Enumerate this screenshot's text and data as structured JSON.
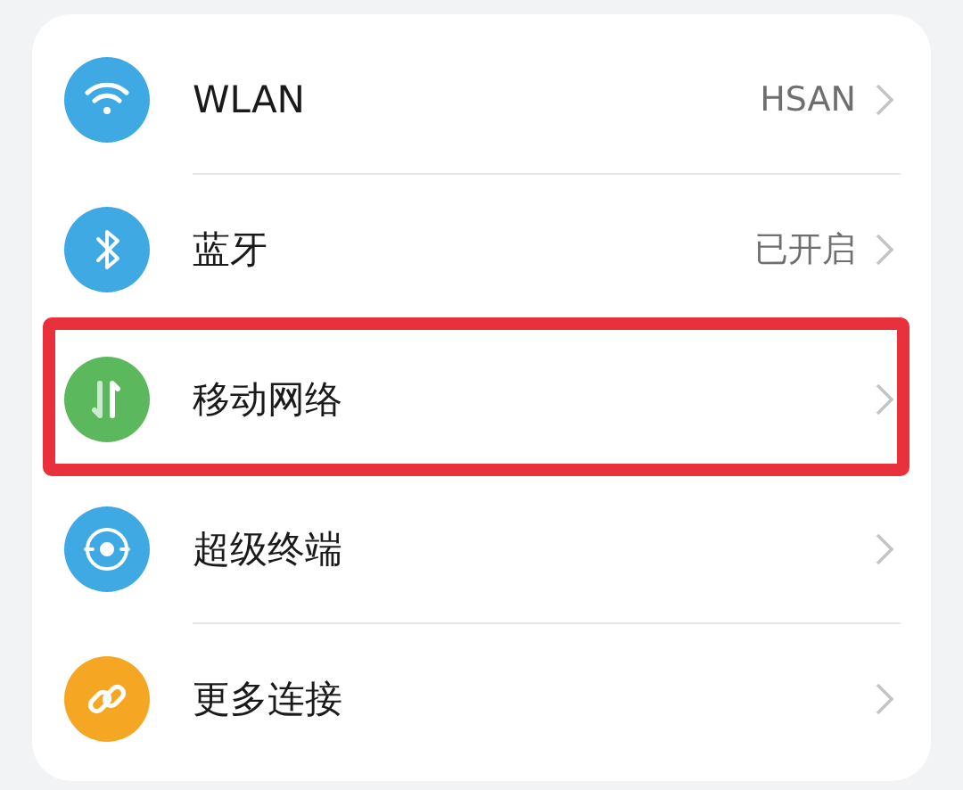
{
  "items": [
    {
      "kind": "wifi",
      "color": "#3fa9e4",
      "label": "WLAN",
      "value": "HSAN",
      "highlighted": false
    },
    {
      "kind": "bluetooth",
      "color": "#3fa9e4",
      "label": "蓝牙",
      "value": "已开启",
      "highlighted": false
    },
    {
      "kind": "mobile-data",
      "color": "#5cb85c",
      "label": "移动网络",
      "highlighted": true
    },
    {
      "kind": "super-device",
      "color": "#3fa9e4",
      "label": "超级终端",
      "highlighted": false
    },
    {
      "kind": "link",
      "color": "#f5a623",
      "label": "更多连接",
      "highlighted": false
    }
  ]
}
